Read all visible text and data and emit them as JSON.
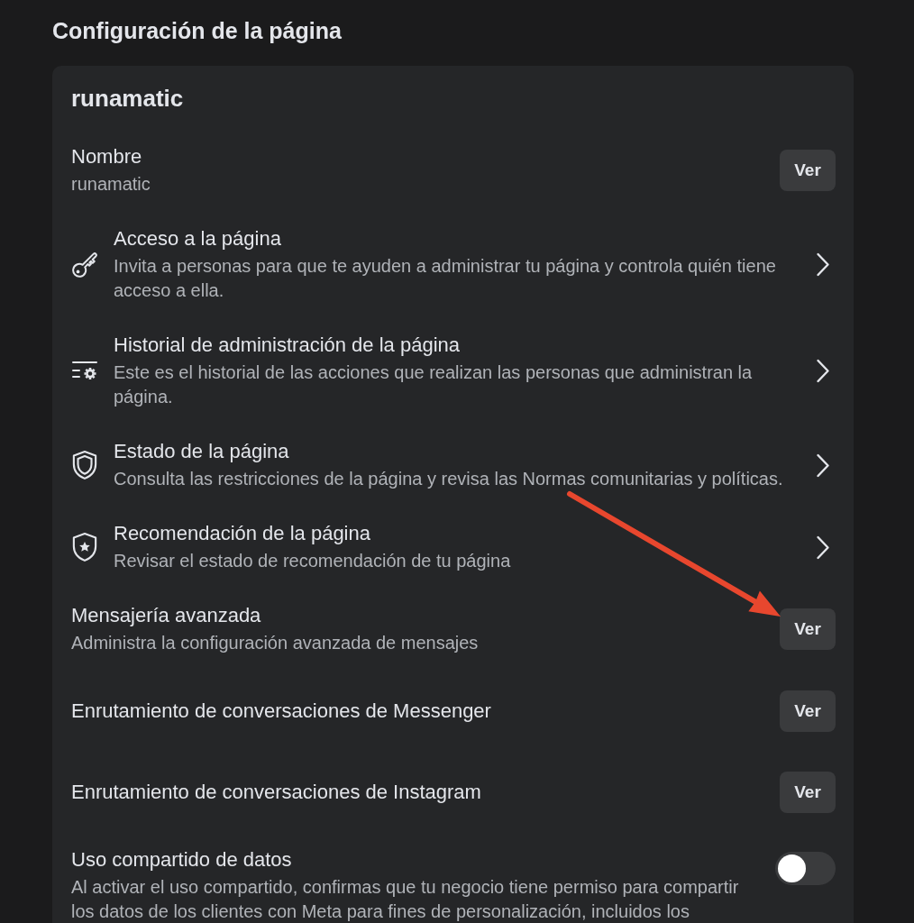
{
  "page_title": "Configuración de la página",
  "card": {
    "title": "runamatic",
    "items": [
      {
        "kind": "button",
        "title": "Nombre",
        "value": "runamatic",
        "button": "Ver"
      },
      {
        "kind": "link",
        "title": "Acceso a la página",
        "description": "Invita a personas para que te ayuden a administrar tu página y controla quién tiene acceso a ella."
      },
      {
        "kind": "link",
        "title": "Historial de administración de la página",
        "description": "Este es el historial de las acciones que realizan las personas que administran la página."
      },
      {
        "kind": "link",
        "title": "Estado de la página",
        "description": "Consulta las restricciones de la página y revisa las Normas comunitarias y políticas."
      },
      {
        "kind": "link",
        "title": "Recomendación de la página",
        "description": "Revisar el estado de recomendación de tu página"
      },
      {
        "kind": "button",
        "title": "Mensajería avanzada",
        "description": "Administra la configuración avanzada de mensajes",
        "button": "Ver"
      },
      {
        "kind": "button",
        "title": "Enrutamiento de conversaciones de Messenger",
        "button": "Ver"
      },
      {
        "kind": "button",
        "title": "Enrutamiento de conversaciones de Instagram",
        "button": "Ver"
      },
      {
        "kind": "toggle",
        "title": "Uso compartido de datos",
        "description": "Al activar el uso compartido, confirmas que tu negocio tiene permiso para compartir los datos de los clientes con Meta para fines de personalización, incluidos los",
        "on": false
      }
    ]
  },
  "annotation": {
    "kind": "arrow"
  }
}
